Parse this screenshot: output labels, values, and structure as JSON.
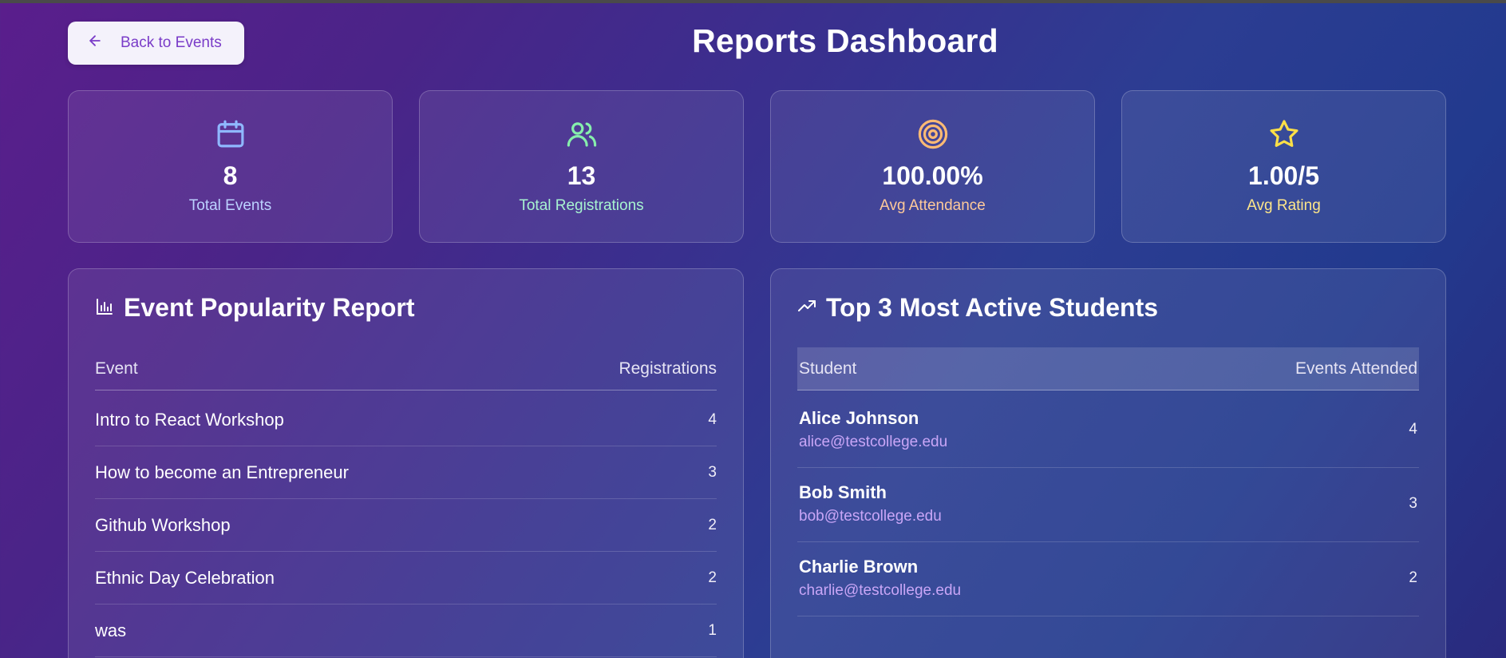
{
  "header": {
    "back_label": "Back to Events",
    "title": "Reports Dashboard"
  },
  "stats": [
    {
      "icon": "calendar-icon",
      "value": "8",
      "label": "Total Events",
      "color": "#8fb8ff"
    },
    {
      "icon": "users-icon",
      "value": "13",
      "label": "Total Registrations",
      "color": "#86efac"
    },
    {
      "icon": "target-icon",
      "value": "100.00%",
      "label": "Avg Attendance",
      "color": "#fdba74"
    },
    {
      "icon": "star-icon",
      "value": "1.00/5",
      "label": "Avg Rating",
      "color": "#fde047"
    }
  ],
  "popularity": {
    "title": "Event Popularity Report",
    "col_event": "Event",
    "col_registrations": "Registrations",
    "rows": [
      {
        "event": "Intro to React Workshop",
        "count": "4"
      },
      {
        "event": "How to become an Entrepreneur",
        "count": "3"
      },
      {
        "event": "Github Workshop",
        "count": "2"
      },
      {
        "event": "Ethnic Day Celebration",
        "count": "2"
      },
      {
        "event": "was",
        "count": "1"
      }
    ]
  },
  "students": {
    "title": "Top 3 Most Active Students",
    "col_student": "Student",
    "col_attended": "Events Attended",
    "rows": [
      {
        "name": "Alice Johnson",
        "email": "alice@testcollege.edu",
        "count": "4"
      },
      {
        "name": "Bob Smith",
        "email": "bob@testcollege.edu",
        "count": "3"
      },
      {
        "name": "Charlie Brown",
        "email": "charlie@testcollege.edu",
        "count": "2"
      }
    ]
  }
}
